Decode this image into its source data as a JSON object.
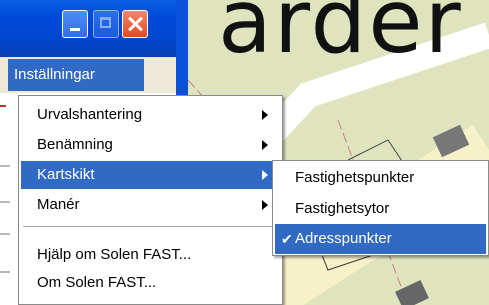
{
  "window": {
    "buttons": {
      "minimize": "minimize-icon",
      "maximize": "maximize-icon",
      "close": "close-icon"
    }
  },
  "menubar": {
    "active_menu": "Inställningar"
  },
  "map": {
    "label_fragment": "arder"
  },
  "menu": {
    "items": [
      {
        "label": "Urvalshantering",
        "submenu": true
      },
      {
        "label": "Benämning",
        "submenu": true
      },
      {
        "label": "Kartskikt",
        "submenu": true,
        "selected": true
      },
      {
        "label": "Manér",
        "submenu": true
      },
      {
        "label": "Hjälp om Solen FAST...",
        "submenu": false
      },
      {
        "label": "Om Solen FAST...",
        "submenu": false
      }
    ]
  },
  "submenu": {
    "items": [
      {
        "label": "Fastighetspunkter",
        "checked": false
      },
      {
        "label": "Fastighetsytor",
        "checked": false
      },
      {
        "label": "Adresspunkter",
        "checked": true,
        "selected": true
      }
    ]
  },
  "colors": {
    "highlight": "#316ac5",
    "titlebar": "#0049d9",
    "map_bg": "#dfe4bf"
  }
}
